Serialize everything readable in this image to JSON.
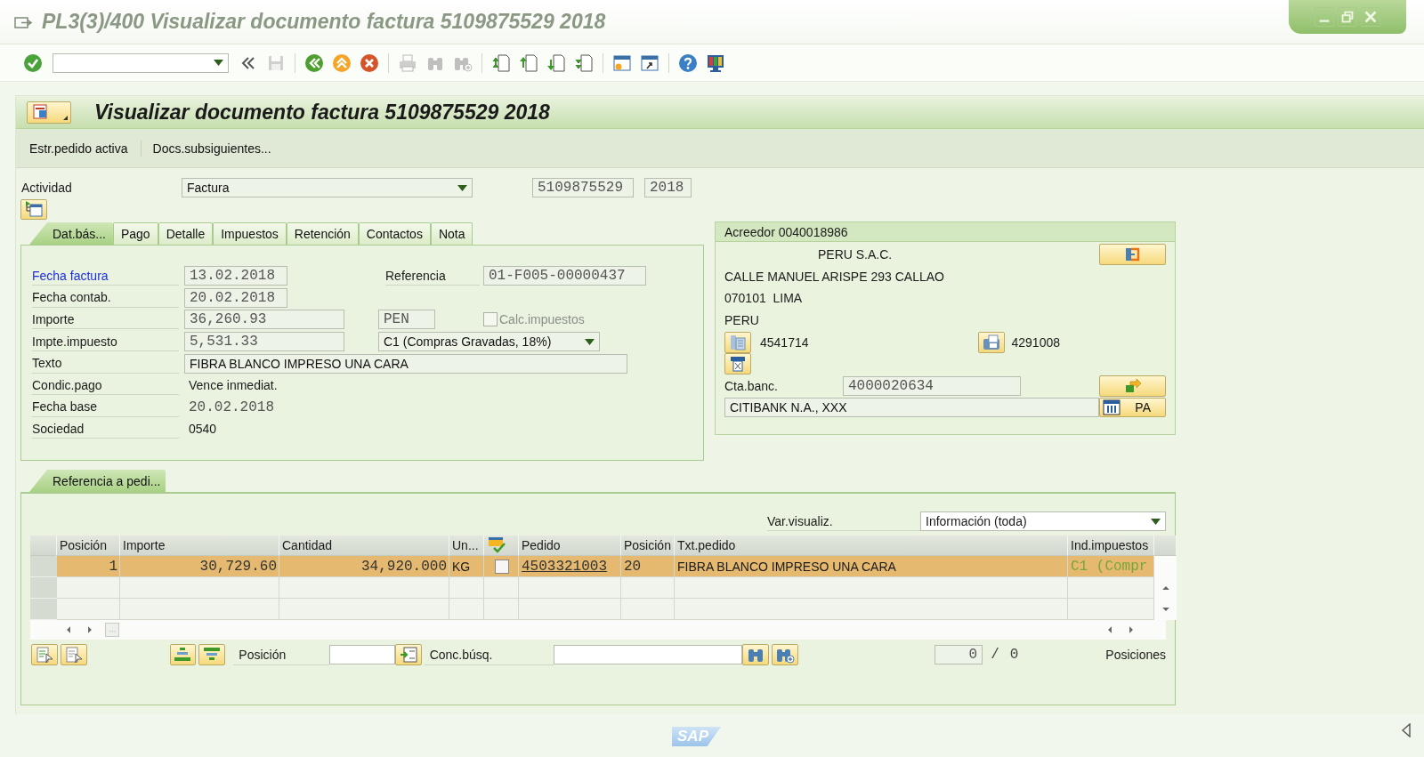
{
  "window": {
    "title": "PL3(3)/400 Visualizar documento factura 5109875529 2018"
  },
  "toolbar": [
    {
      "disabled": false
    },
    {
      "disabled": true
    },
    {
      "disabled": false
    },
    {
      "disabled": false
    },
    {
      "disabled": false
    },
    {
      "disabled": true
    },
    {
      "disabled": true
    },
    {
      "disabled": true
    },
    {
      "disabled": false
    },
    {
      "disabled": false
    },
    {
      "disabled": false
    },
    {
      "disabled": false
    },
    {
      "disabled": false
    },
    {
      "disabled": false
    },
    {
      "disabled": false
    },
    {
      "disabled": false
    }
  ],
  "header": {
    "title": "Visualizar documento factura 5109875529 2018"
  },
  "menu": [
    "Estr.pedido activa",
    "Docs.subsiguientes..."
  ],
  "activity": {
    "label": "Actividad",
    "value": "Factura",
    "document_number": "5109875529",
    "year": "2018"
  },
  "tabs": [
    {
      "label": "Dat.bás...",
      "selected": true
    },
    {
      "label": "Pago",
      "selected": false
    },
    {
      "label": "Detalle",
      "selected": false
    },
    {
      "label": "Impuestos",
      "selected": false
    },
    {
      "label": "Retención",
      "selected": false
    },
    {
      "label": "Contactos",
      "selected": false
    },
    {
      "label": "Nota",
      "selected": false
    }
  ],
  "basic_data": {
    "fields": [
      {
        "label": "Fecha factura",
        "value": "13.02.2018",
        "kind": "date",
        "highlighted": true
      },
      {
        "label": "Fecha contab.",
        "value": "20.02.2018",
        "kind": "date",
        "highlighted": false
      },
      {
        "label": "Importe",
        "value": "36,260.93",
        "kind": "amount",
        "highlighted": false
      },
      {
        "label": "Impte.impuesto",
        "value": "5,531.33",
        "kind": "amount",
        "highlighted": false
      },
      {
        "label": "Texto",
        "value": "FIBRA BLANCO IMPRESO UNA CARA",
        "kind": "long",
        "highlighted": false
      },
      {
        "label": "Condic.pago",
        "value": "Vence inmediat.",
        "kind": "output",
        "highlighted": false
      },
      {
        "label": "Fecha base",
        "value": "20.02.2018",
        "kind": "output_mono",
        "highlighted": false
      },
      {
        "label": "Sociedad",
        "value": "0540",
        "kind": "output",
        "highlighted": false
      }
    ],
    "reference": {
      "label": "Referencia",
      "value": "01-F005-00000437"
    },
    "currency": "PEN",
    "calc_taxes": {
      "label": "Calc.impuestos",
      "checked": false,
      "disabled": true
    },
    "tax_code": "C1 (Compras Gravadas, 18%)"
  },
  "vendor": {
    "title": "Acreedor 0040018986",
    "name": "PERU S.A.C.",
    "address_lines": [
      "CALLE MANUEL ARISPE 293 CALLAO",
      "070101  LIMA",
      "PERU"
    ],
    "phone": "4541714",
    "fax": "4291008",
    "bank_account": {
      "label": "Cta.banc.",
      "value": "4000020634"
    },
    "bank_name": "CITIBANK N.A., XXX",
    "bank_country": "PA"
  },
  "items": {
    "tab": {
      "label": "Referencia a pedi...",
      "selected": true
    },
    "layout": {
      "label": "Var.visualiz.",
      "value": "Información (toda)"
    },
    "columns": [
      {
        "kind": "number",
        "label": "Posición"
      },
      {
        "kind": "number",
        "label": "Importe"
      },
      {
        "kind": "number",
        "label": "Cantidad"
      },
      {
        "kind": "text",
        "label": "Un..."
      },
      {
        "kind": "check"
      },
      {
        "kind": "link",
        "label": "Pedido"
      },
      {
        "kind": "code",
        "label": "Posición"
      },
      {
        "kind": "text",
        "label": "Txt.pedido"
      },
      {
        "kind": "inactive",
        "label": "Ind.impuestos"
      }
    ],
    "rows": [
      {
        "selected": true,
        "cells": [
          "1",
          "30,729.60",
          "34,920.000",
          "KG",
          {
            "checked": false
          },
          "4503321003",
          "20",
          "FIBRA BLANCO IMPRESO UNA CARA",
          "C1 (Compr"
        ]
      }
    ],
    "search": {
      "position_label": "Posición",
      "query_label": "Conc.búsq."
    },
    "counter": {
      "current": "0",
      "separator": "/",
      "total": "0",
      "label": "Posiciones"
    }
  },
  "status_bar": {
    "logo": "SAP"
  }
}
